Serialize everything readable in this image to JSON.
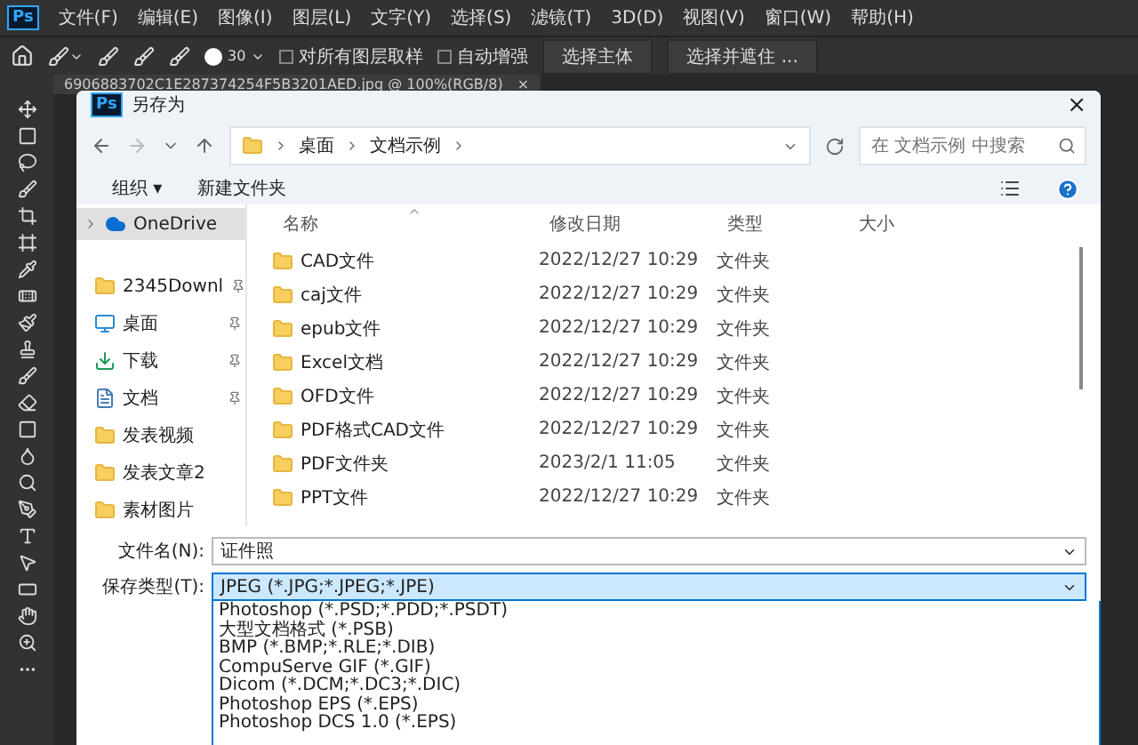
{
  "app": {
    "logo": "Ps",
    "menu": [
      "文件(F)",
      "编辑(E)",
      "图像(I)",
      "图层(L)",
      "文字(Y)",
      "选择(S)",
      "滤镜(T)",
      "3D(D)",
      "视图(V)",
      "窗口(W)",
      "帮助(H)"
    ]
  },
  "options_bar": {
    "brush_size": "30",
    "checkboxes": [
      {
        "label": "对所有图层取样",
        "checked": false
      },
      {
        "label": "自动增强",
        "checked": false
      }
    ],
    "buttons": [
      "选择主体",
      "选择并遮住 ..."
    ]
  },
  "document_tab": {
    "title": "6906883702C1E287374254F5B3201AED.jpg @ 100%(RGB/8)",
    "close": "×"
  },
  "dialog": {
    "logo": "Ps",
    "title": "另存为",
    "close": "×",
    "breadcrumb": [
      "桌面",
      "文档示例"
    ],
    "search": {
      "placeholder": "在 文档示例 中搜索"
    },
    "toolbar": {
      "organize": "组织 ▾",
      "new_folder": "新建文件夹"
    },
    "sidebar": [
      {
        "label": "OneDrive",
        "kind": "cloud",
        "pinned": false,
        "selected": true
      },
      {
        "label": "2345Downl",
        "kind": "folder",
        "pinned": true,
        "selected": false
      },
      {
        "label": "桌面",
        "kind": "desktop",
        "pinned": true,
        "selected": false
      },
      {
        "label": "下载",
        "kind": "download",
        "pinned": true,
        "selected": false
      },
      {
        "label": "文档",
        "kind": "document",
        "pinned": true,
        "selected": false
      },
      {
        "label": "发表视频",
        "kind": "folder",
        "pinned": false,
        "selected": false
      },
      {
        "label": "发表文章2",
        "kind": "folder",
        "pinned": false,
        "selected": false
      },
      {
        "label": "素材图片",
        "kind": "folder",
        "pinned": false,
        "selected": false
      }
    ],
    "columns": [
      "名称",
      "修改日期",
      "类型",
      "大小"
    ],
    "rows": [
      {
        "name": "CAD文件",
        "date": "2022/12/27 10:29",
        "type": "文件夹"
      },
      {
        "name": "caj文件",
        "date": "2022/12/27 10:29",
        "type": "文件夹"
      },
      {
        "name": "epub文件",
        "date": "2022/12/27 10:29",
        "type": "文件夹"
      },
      {
        "name": "Excel文档",
        "date": "2022/12/27 10:29",
        "type": "文件夹"
      },
      {
        "name": "OFD文件",
        "date": "2022/12/27 10:29",
        "type": "文件夹"
      },
      {
        "name": "PDF格式CAD文件",
        "date": "2022/12/27 10:29",
        "type": "文件夹"
      },
      {
        "name": "PDF文件夹",
        "date": "2023/2/1 11:05",
        "type": "文件夹"
      },
      {
        "name": "PPT文件",
        "date": "2022/12/27 10:29",
        "type": "文件夹"
      }
    ],
    "filename": {
      "label": "文件名(N):",
      "value": "证件照"
    },
    "filetype": {
      "label": "保存类型(T):",
      "value": "JPEG (*.JPG;*.JPEG;*.JPE)",
      "options": [
        "Photoshop (*.PSD;*.PDD;*.PSDT)",
        "大型文档格式 (*.PSB)",
        "BMP (*.BMP;*.RLE;*.DIB)",
        "CompuServe GIF (*.GIF)",
        "Dicom (*.DCM;*.DC3;*.DIC)",
        "Photoshop EPS (*.EPS)",
        "Photoshop DCS 1.0 (*.EPS)"
      ]
    }
  }
}
